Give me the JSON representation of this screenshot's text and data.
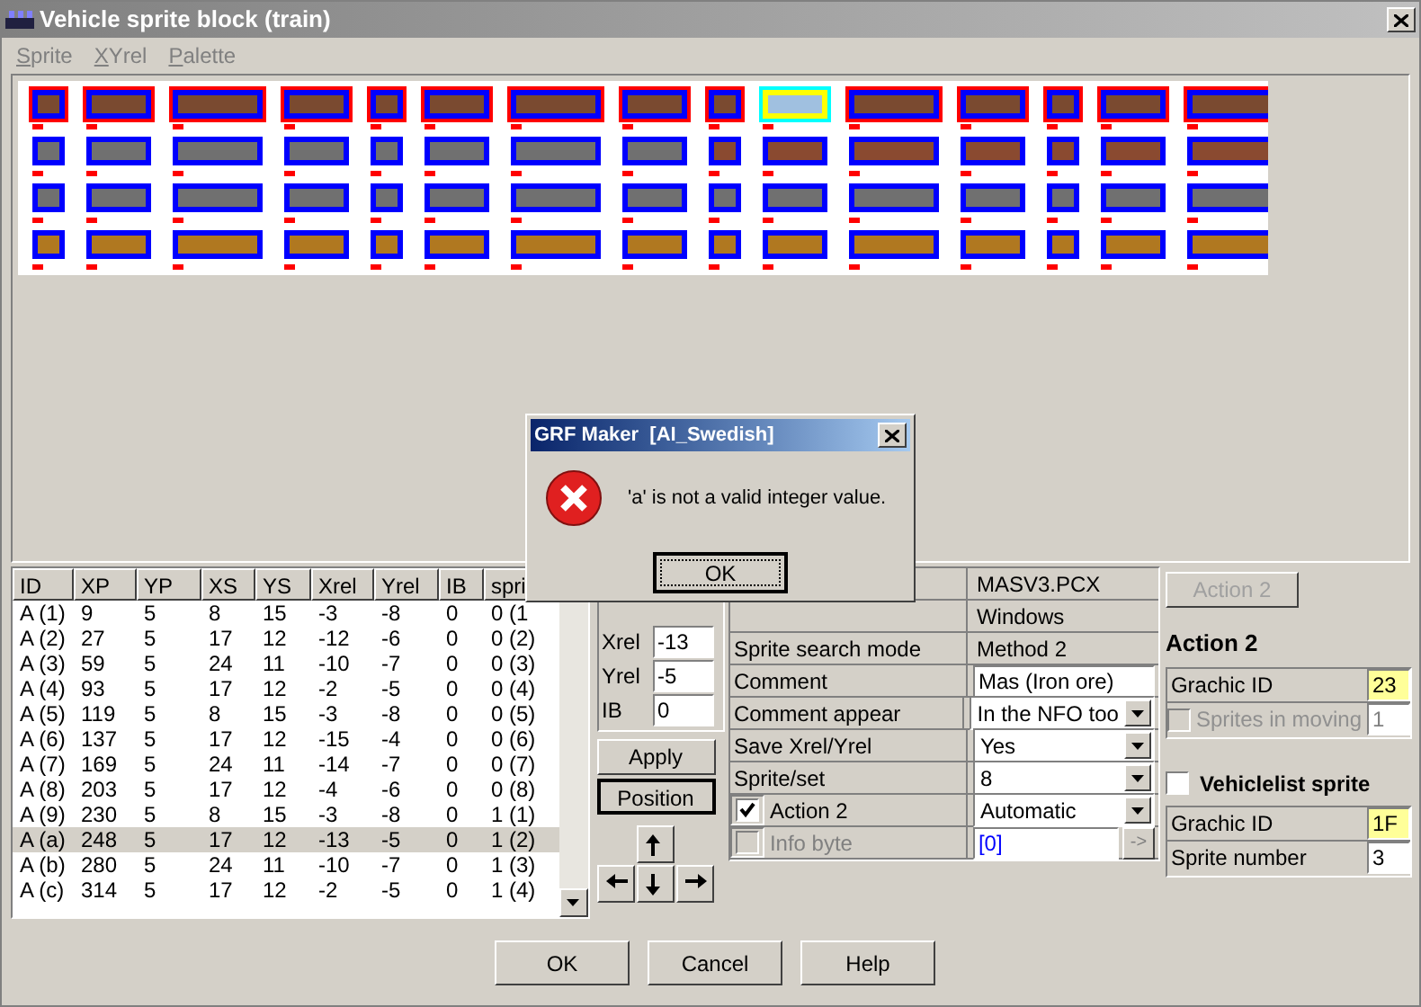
{
  "window": {
    "title": "Vehicle sprite block (train)"
  },
  "menu": [
    "Sprite",
    "XYrel",
    "Palette"
  ],
  "sprite_table": {
    "columns": [
      "ID",
      "XP",
      "YP",
      "XS",
      "YS",
      "Xrel",
      "Yrel",
      "IB",
      "spri"
    ],
    "rows": [
      {
        "cells": [
          "A (1)",
          "9",
          "5",
          "8",
          "15",
          "-3",
          "-8",
          "0",
          "0 (1"
        ],
        "selected": false
      },
      {
        "cells": [
          "A (2)",
          "27",
          "5",
          "17",
          "12",
          "-12",
          "-6",
          "0",
          "0 (2)"
        ],
        "selected": false
      },
      {
        "cells": [
          "A (3)",
          "59",
          "5",
          "24",
          "11",
          "-10",
          "-7",
          "0",
          "0 (3)"
        ],
        "selected": false
      },
      {
        "cells": [
          "A (4)",
          "93",
          "5",
          "17",
          "12",
          "-2",
          "-5",
          "0",
          "0 (4)"
        ],
        "selected": false
      },
      {
        "cells": [
          "A (5)",
          "119",
          "5",
          "8",
          "15",
          "-3",
          "-8",
          "0",
          "0 (5)"
        ],
        "selected": false
      },
      {
        "cells": [
          "A (6)",
          "137",
          "5",
          "17",
          "12",
          "-15",
          "-4",
          "0",
          "0 (6)"
        ],
        "selected": false
      },
      {
        "cells": [
          "A (7)",
          "169",
          "5",
          "24",
          "11",
          "-14",
          "-7",
          "0",
          "0 (7)"
        ],
        "selected": false
      },
      {
        "cells": [
          "A (8)",
          "203",
          "5",
          "17",
          "12",
          "-4",
          "-6",
          "0",
          "0 (8)"
        ],
        "selected": false
      },
      {
        "cells": [
          "A (9)",
          "230",
          "5",
          "8",
          "15",
          "-3",
          "-8",
          "0",
          "1 (1)"
        ],
        "selected": false
      },
      {
        "cells": [
          "A (a)",
          "248",
          "5",
          "17",
          "12",
          "-13",
          "-5",
          "0",
          "1 (2)"
        ],
        "selected": true
      },
      {
        "cells": [
          "A (b)",
          "280",
          "5",
          "24",
          "11",
          "-10",
          "-7",
          "0",
          "1 (3)"
        ],
        "selected": false
      },
      {
        "cells": [
          "A (c)",
          "314",
          "5",
          "17",
          "12",
          "-2",
          "-5",
          "0",
          "1 (4)"
        ],
        "selected": false
      }
    ]
  },
  "offset_fields": [
    {
      "label": "Xrel",
      "value": "-13"
    },
    {
      "label": "Yrel",
      "value": "-5"
    },
    {
      "label": "IB",
      "value": "0"
    }
  ],
  "apply_button": "Apply",
  "position_button": "Position",
  "properties": [
    {
      "kind": "text",
      "value": "MASV3.PCX"
    },
    {
      "kind": "text",
      "value": "Windows"
    },
    {
      "kind": "text",
      "label": "Sprite search mode",
      "value": "Method 2"
    },
    {
      "kind": "input",
      "label": "Comment",
      "value": "Mas (Iron ore)"
    },
    {
      "kind": "select",
      "label": "Comment appear",
      "value": "In the NFO too"
    },
    {
      "kind": "select",
      "label": "Save Xrel/Yrel",
      "value": "Yes"
    },
    {
      "kind": "select",
      "label": "Sprite/set",
      "value": "8"
    },
    {
      "kind": "check_select",
      "label": "Action 2",
      "value": "Automatic",
      "checked": true,
      "disabled": false
    },
    {
      "kind": "check_input",
      "label": "Info byte",
      "value": "[0]",
      "checked": false,
      "disabled": true,
      "go": "->"
    }
  ],
  "action2_button": {
    "label": "Action 2",
    "disabled": true
  },
  "action2": {
    "heading": "Action 2",
    "graphic_id": {
      "label": "Grachic ID",
      "value": "23"
    },
    "sprites_in_moving": {
      "label": "Sprites in moving",
      "value": "1",
      "checked": false,
      "disabled": true
    }
  },
  "vehiclelist": {
    "label": "Vehiclelist sprite",
    "checked": false,
    "graphic_id": {
      "label": "Grachic ID",
      "value": "1F"
    },
    "sprite_number": {
      "label": "Sprite number",
      "value": "3"
    }
  },
  "footer_buttons": [
    "OK",
    "Cancel",
    "Help"
  ],
  "dialog": {
    "title": "GRF Maker  [AI_Swedish]",
    "message": "'a' is not a valid integer value.",
    "button": "OK"
  }
}
